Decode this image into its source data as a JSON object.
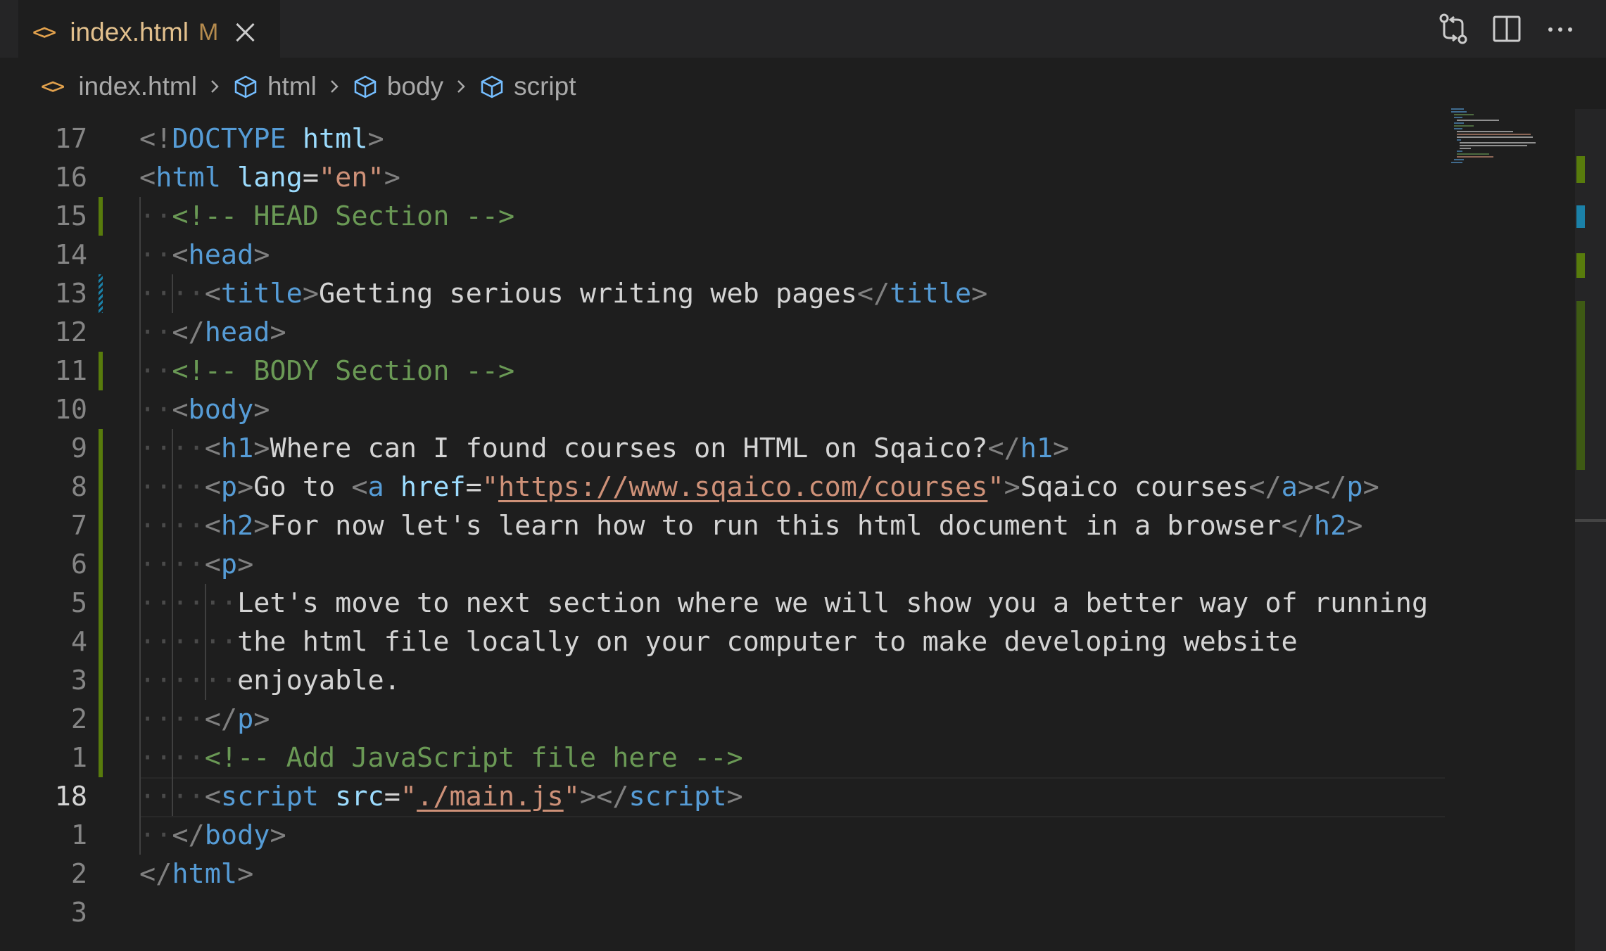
{
  "tab": {
    "title": "index.html",
    "modified_badge": "M",
    "close_icon": "close-icon",
    "file_icon": "code-icon",
    "title_color": "#e2c08d"
  },
  "actions": [
    {
      "name": "open-changes-icon"
    },
    {
      "name": "split-editor-icon"
    },
    {
      "name": "more-actions-icon"
    }
  ],
  "breadcrumb": [
    "index.html",
    "html",
    "body",
    "script"
  ],
  "colors": {
    "tag": "#569cd6",
    "attribute": "#9cdcfe",
    "string": "#ce9178",
    "comment": "#6a9955",
    "text": "#d4d4d4",
    "added": "#587c0c",
    "modified": "#1b81a8"
  },
  "editor": {
    "active_line_index": 17,
    "lines": [
      {
        "num": "17",
        "indent": 0,
        "change": "",
        "tokens": [
          [
            "punc",
            "<!"
          ],
          [
            "tag",
            "DOCTYPE"
          ],
          [
            "text",
            " "
          ],
          [
            "attr",
            "html"
          ],
          [
            "punc",
            ">"
          ]
        ]
      },
      {
        "num": "16",
        "indent": 0,
        "change": "",
        "tokens": [
          [
            "punc",
            "<"
          ],
          [
            "tag",
            "html"
          ],
          [
            "text",
            " "
          ],
          [
            "attr",
            "lang"
          ],
          [
            "text",
            "="
          ],
          [
            "str",
            "\"en\""
          ],
          [
            "punc",
            ">"
          ]
        ]
      },
      {
        "num": "15",
        "indent": 1,
        "change": "added",
        "tokens": [
          [
            "com",
            "<!-- HEAD Section -->"
          ]
        ]
      },
      {
        "num": "14",
        "indent": 1,
        "change": "",
        "tokens": [
          [
            "punc",
            "<"
          ],
          [
            "tag",
            "head"
          ],
          [
            "punc",
            ">"
          ]
        ]
      },
      {
        "num": "13",
        "indent": 2,
        "change": "modified",
        "tokens": [
          [
            "punc",
            "<"
          ],
          [
            "tag",
            "title"
          ],
          [
            "punc",
            ">"
          ],
          [
            "text",
            "Getting serious writing web pages"
          ],
          [
            "punc",
            "</"
          ],
          [
            "tag",
            "title"
          ],
          [
            "punc",
            ">"
          ]
        ]
      },
      {
        "num": "12",
        "indent": 1,
        "change": "",
        "tokens": [
          [
            "punc",
            "</"
          ],
          [
            "tag",
            "head"
          ],
          [
            "punc",
            ">"
          ]
        ]
      },
      {
        "num": "11",
        "indent": 1,
        "change": "added",
        "tokens": [
          [
            "com",
            "<!-- BODY Section -->"
          ]
        ]
      },
      {
        "num": "10",
        "indent": 1,
        "change": "",
        "tokens": [
          [
            "punc",
            "<"
          ],
          [
            "tag",
            "body"
          ],
          [
            "punc",
            ">"
          ]
        ]
      },
      {
        "num": "9",
        "indent": 2,
        "change": "added",
        "tokens": [
          [
            "punc",
            "<"
          ],
          [
            "tag",
            "h1"
          ],
          [
            "punc",
            ">"
          ],
          [
            "text",
            "Where can I found courses on HTML on Sqaico?"
          ],
          [
            "punc",
            "</"
          ],
          [
            "tag",
            "h1"
          ],
          [
            "punc",
            ">"
          ]
        ]
      },
      {
        "num": "8",
        "indent": 2,
        "change": "added",
        "tokens": [
          [
            "punc",
            "<"
          ],
          [
            "tag",
            "p"
          ],
          [
            "punc",
            ">"
          ],
          [
            "text",
            "Go to "
          ],
          [
            "punc",
            "<"
          ],
          [
            "tag",
            "a"
          ],
          [
            "text",
            " "
          ],
          [
            "attr",
            "href"
          ],
          [
            "text",
            "="
          ],
          [
            "str",
            "\""
          ],
          [
            "link",
            "https://www.sqaico.com/courses"
          ],
          [
            "str",
            "\""
          ],
          [
            "punc",
            ">"
          ],
          [
            "text",
            "Sqaico courses"
          ],
          [
            "punc",
            "</"
          ],
          [
            "tag",
            "a"
          ],
          [
            "punc",
            "></"
          ],
          [
            "tag",
            "p"
          ],
          [
            "punc",
            ">"
          ]
        ]
      },
      {
        "num": "7",
        "indent": 2,
        "change": "added",
        "tokens": [
          [
            "punc",
            "<"
          ],
          [
            "tag",
            "h2"
          ],
          [
            "punc",
            ">"
          ],
          [
            "text",
            "For now let's learn how to run this html document in a browser"
          ],
          [
            "punc",
            "</"
          ],
          [
            "tag",
            "h2"
          ],
          [
            "punc",
            ">"
          ]
        ]
      },
      {
        "num": "6",
        "indent": 2,
        "change": "added",
        "tokens": [
          [
            "punc",
            "<"
          ],
          [
            "tag",
            "p"
          ],
          [
            "punc",
            ">"
          ]
        ]
      },
      {
        "num": "5",
        "indent": 3,
        "change": "added",
        "tokens": [
          [
            "text",
            "Let's move to next section where we will show you a better way of running"
          ]
        ]
      },
      {
        "num": "4",
        "indent": 3,
        "change": "added",
        "tokens": [
          [
            "text",
            "the html file locally on your computer to make developing website"
          ]
        ]
      },
      {
        "num": "3",
        "indent": 3,
        "change": "added",
        "tokens": [
          [
            "text",
            "enjoyable."
          ]
        ]
      },
      {
        "num": "2",
        "indent": 2,
        "change": "added",
        "tokens": [
          [
            "punc",
            "</"
          ],
          [
            "tag",
            "p"
          ],
          [
            "punc",
            ">"
          ]
        ]
      },
      {
        "num": "1",
        "indent": 2,
        "change": "added",
        "tokens": [
          [
            "com",
            "<!-- Add JavaScript file here -->"
          ]
        ]
      },
      {
        "num": "18",
        "indent": 2,
        "change": "",
        "tokens": [
          [
            "punc",
            "<"
          ],
          [
            "tag",
            "script"
          ],
          [
            "text",
            " "
          ],
          [
            "attr",
            "src"
          ],
          [
            "text",
            "="
          ],
          [
            "str",
            "\""
          ],
          [
            "link",
            "./main.js"
          ],
          [
            "str",
            "\""
          ],
          [
            "punc",
            "></"
          ],
          [
            "tag",
            "script"
          ],
          [
            "punc",
            ">"
          ]
        ]
      },
      {
        "num": "1",
        "indent": 1,
        "change": "",
        "tokens": [
          [
            "punc",
            "</"
          ],
          [
            "tag",
            "body"
          ],
          [
            "punc",
            ">"
          ]
        ]
      },
      {
        "num": "2",
        "indent": 0,
        "change": "",
        "tokens": [
          [
            "punc",
            "</"
          ],
          [
            "tag",
            "html"
          ],
          [
            "punc",
            ">"
          ]
        ]
      },
      {
        "num": "3",
        "indent": 0,
        "change": "",
        "tokens": []
      }
    ]
  }
}
